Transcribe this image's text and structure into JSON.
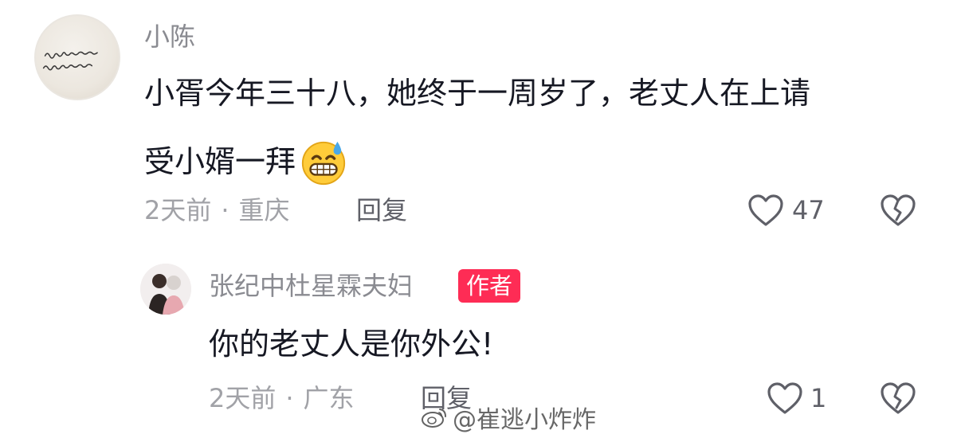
{
  "comment": {
    "avatar_icon": "handwriting-avatar-icon",
    "username": "小陈",
    "content_line1": "小胥今年三十八，她终于一周岁了，老丈人在上请",
    "content_line2": "受小婿一拜",
    "emoji_icon": "grinning-sweat-emoji-icon",
    "time": "2天前",
    "separator": "·",
    "location": "重庆",
    "reply_label": "回复",
    "like_icon": "heart-outline-icon",
    "like_count": "47",
    "dislike_icon": "broken-heart-icon"
  },
  "reply": {
    "avatar_icon": "couple-avatar-icon",
    "username": "张纪中杜星霖夫妇",
    "author_badge": "作者",
    "content": "你的老丈人是你外公!",
    "time": "2天前",
    "separator": "·",
    "location": "广东",
    "reply_label": "回复",
    "like_icon": "heart-outline-icon",
    "like_count": "1",
    "dislike_icon": "broken-heart-icon"
  },
  "watermark": {
    "icon": "weibo-icon",
    "text": "@崔逃小炸炸"
  },
  "colors": {
    "author_badge_bg": "#fe2c55",
    "text_primary": "#161823",
    "text_secondary": "#8a8b91"
  }
}
